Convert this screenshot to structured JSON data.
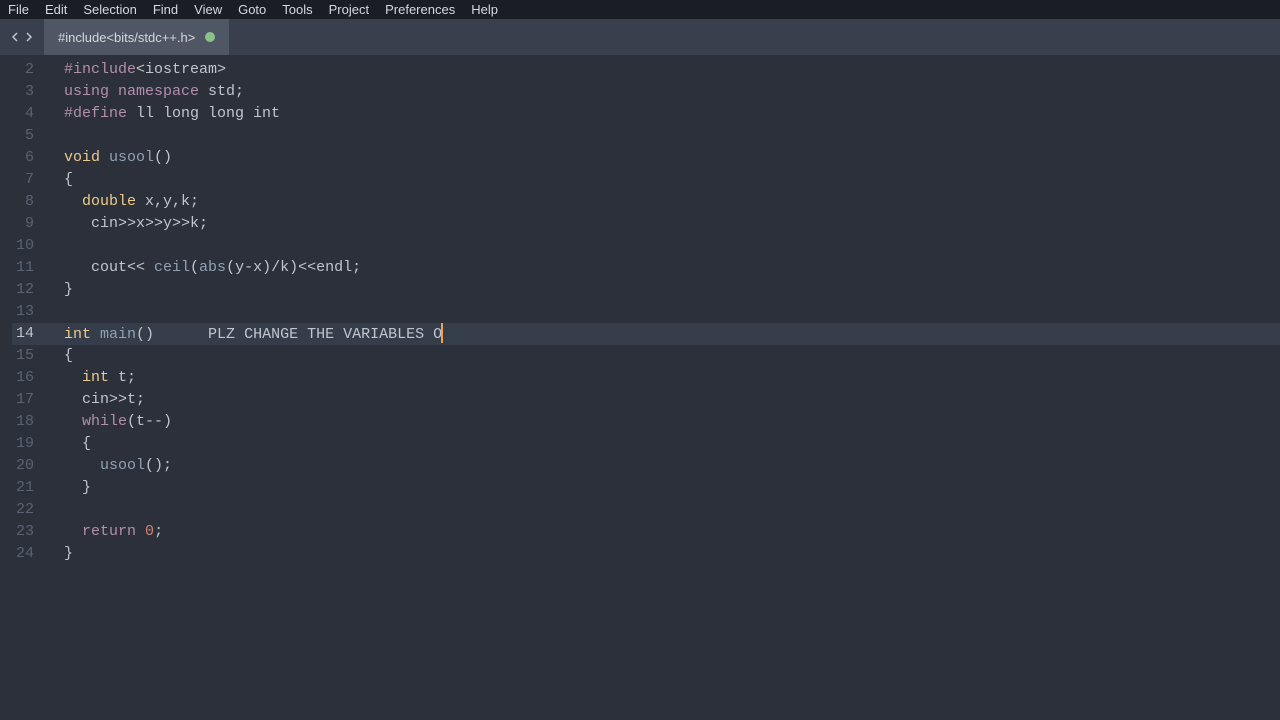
{
  "menubar": {
    "items": [
      "File",
      "Edit",
      "Selection",
      "Find",
      "View",
      "Goto",
      "Tools",
      "Project",
      "Preferences",
      "Help"
    ]
  },
  "tab": {
    "title": "#include<bits/stdc++.h>"
  },
  "gutter": {
    "start": 2,
    "end": 24
  },
  "code": {
    "lines": [
      {
        "n": 2,
        "segs": [
          [
            "pp",
            "#include"
          ],
          [
            "plain",
            "<iostream>"
          ]
        ]
      },
      {
        "n": 3,
        "segs": [
          [
            "kw",
            "using"
          ],
          [
            "plain",
            " "
          ],
          [
            "kw",
            "namespace"
          ],
          [
            "plain",
            " std;"
          ]
        ]
      },
      {
        "n": 4,
        "segs": [
          [
            "pp",
            "#define"
          ],
          [
            "plain",
            " ll long long int"
          ]
        ]
      },
      {
        "n": 5,
        "segs": []
      },
      {
        "n": 6,
        "segs": [
          [
            "type",
            "void"
          ],
          [
            "plain",
            " "
          ],
          [
            "fn",
            "usool"
          ],
          [
            "plain",
            "()"
          ]
        ]
      },
      {
        "n": 7,
        "segs": [
          [
            "plain",
            "{"
          ]
        ]
      },
      {
        "n": 8,
        "segs": [
          [
            "plain",
            "  "
          ],
          [
            "type",
            "double"
          ],
          [
            "plain",
            " x,y,k;"
          ]
        ]
      },
      {
        "n": 9,
        "segs": [
          [
            "plain",
            "   cin>>x>>y>>k;"
          ]
        ]
      },
      {
        "n": 10,
        "segs": []
      },
      {
        "n": 11,
        "segs": [
          [
            "plain",
            "   cout<< "
          ],
          [
            "fn",
            "ceil"
          ],
          [
            "plain",
            "("
          ],
          [
            "fn",
            "abs"
          ],
          [
            "plain",
            "(y-x)/k)<<endl;"
          ]
        ]
      },
      {
        "n": 12,
        "segs": [
          [
            "plain",
            "}"
          ]
        ]
      },
      {
        "n": 13,
        "segs": []
      },
      {
        "n": 14,
        "active": true,
        "cursor": true,
        "segs": [
          [
            "type",
            "int"
          ],
          [
            "plain",
            " "
          ],
          [
            "fn",
            "main"
          ],
          [
            "plain",
            "()      PLZ CHANGE THE VARIABLES O"
          ]
        ]
      },
      {
        "n": 15,
        "segs": [
          [
            "plain",
            "{"
          ]
        ]
      },
      {
        "n": 16,
        "segs": [
          [
            "plain",
            "  "
          ],
          [
            "type",
            "int"
          ],
          [
            "plain",
            " t;"
          ]
        ]
      },
      {
        "n": 17,
        "segs": [
          [
            "plain",
            "  cin>>t;"
          ]
        ]
      },
      {
        "n": 18,
        "segs": [
          [
            "plain",
            "  "
          ],
          [
            "kw",
            "while"
          ],
          [
            "plain",
            "(t--)"
          ]
        ]
      },
      {
        "n": 19,
        "segs": [
          [
            "plain",
            "  {"
          ]
        ]
      },
      {
        "n": 20,
        "segs": [
          [
            "plain",
            "    "
          ],
          [
            "fn",
            "usool"
          ],
          [
            "plain",
            "();"
          ]
        ]
      },
      {
        "n": 21,
        "segs": [
          [
            "plain",
            "  }"
          ]
        ]
      },
      {
        "n": 22,
        "segs": []
      },
      {
        "n": 23,
        "segs": [
          [
            "plain",
            "  "
          ],
          [
            "kw",
            "return"
          ],
          [
            "plain",
            " "
          ],
          [
            "num",
            "0"
          ],
          [
            "plain",
            ";"
          ]
        ]
      },
      {
        "n": 24,
        "segs": [
          [
            "plain",
            "}"
          ]
        ]
      }
    ]
  }
}
